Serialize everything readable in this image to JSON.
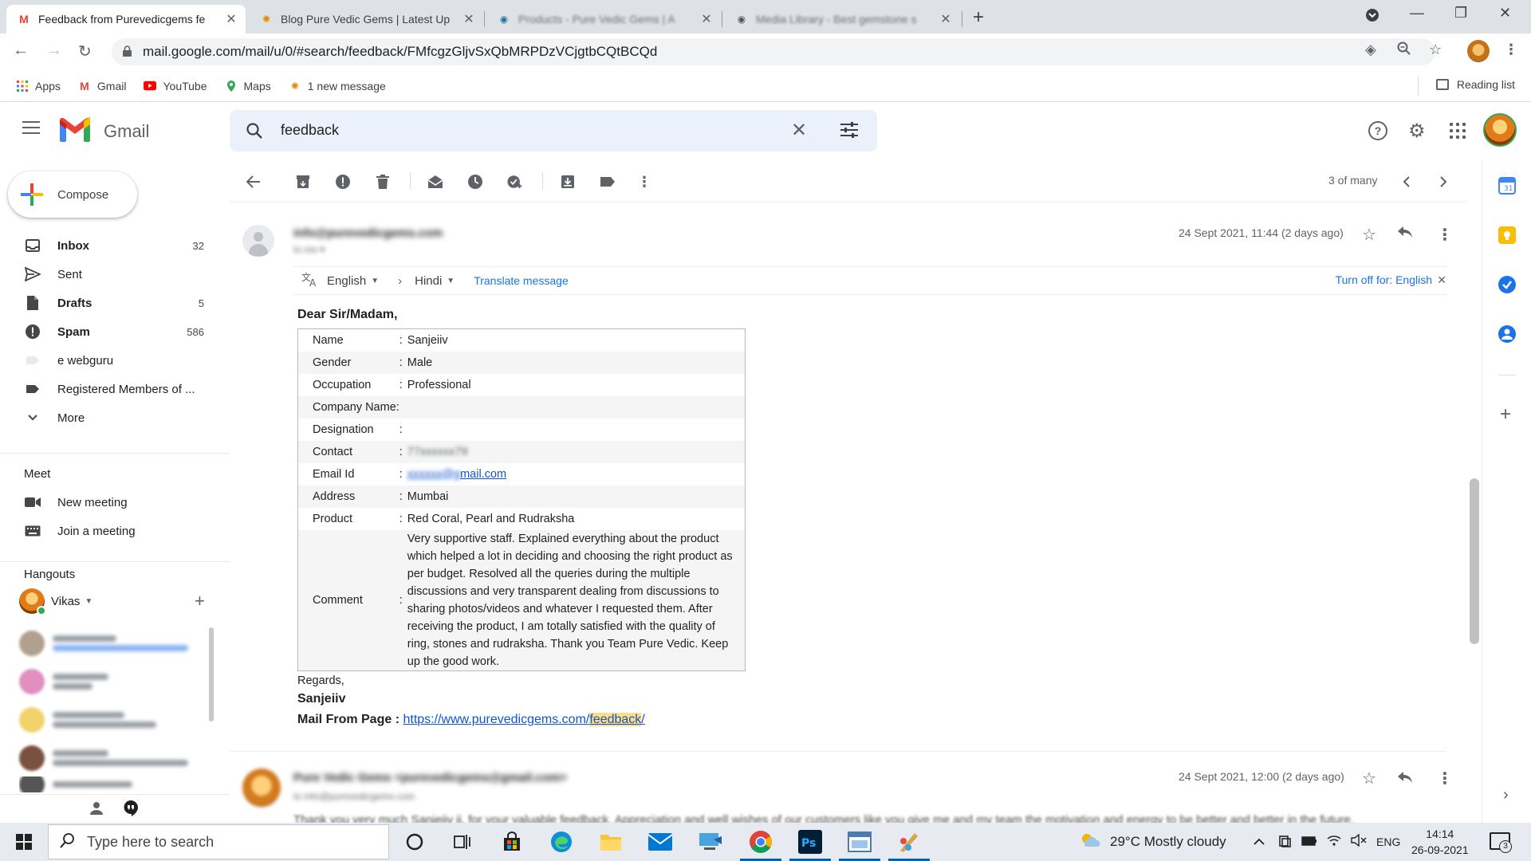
{
  "browser": {
    "tabs": [
      {
        "title": "Feedback from Purevedicgems fe",
        "active": true
      },
      {
        "title": "Blog Pure Vedic Gems | Latest Up",
        "active": false
      },
      {
        "title": "Products - Pure Vedic Gems | A",
        "active": false
      },
      {
        "title": "Media Library - Best gemstone s",
        "active": false
      }
    ],
    "url": "mail.google.com/mail/u/0/#search/feedback/FMfcgzGljvSxQbMRPDzVCjgtbCQtBCQd",
    "bookmarks": [
      "Apps",
      "Gmail",
      "YouTube",
      "Maps",
      "1 new message"
    ],
    "reading_list": "Reading list"
  },
  "gmail": {
    "wordmark": "Gmail",
    "search_query": "feedback",
    "compose_label": "Compose",
    "nav": [
      {
        "label": "Inbox",
        "count": "32",
        "bold": true
      },
      {
        "label": "Sent",
        "count": "",
        "bold": false
      },
      {
        "label": "Drafts",
        "count": "5",
        "bold": true
      },
      {
        "label": "Spam",
        "count": "586",
        "bold": true
      },
      {
        "label": "e webguru",
        "count": "",
        "bold": false
      },
      {
        "label": "Registered Members of ...",
        "count": "",
        "bold": false
      },
      {
        "label": "More",
        "count": "",
        "bold": false
      }
    ],
    "meet": {
      "heading": "Meet",
      "new_meeting": "New meeting",
      "join_meeting": "Join a meeting"
    },
    "hangouts": {
      "heading": "Hangouts",
      "user": "Vikas"
    },
    "pager": "3 of many"
  },
  "message": {
    "date": "24 Sept 2021, 11:44 (2 days ago)",
    "translate": {
      "from": "English",
      "to": "Hindi",
      "action": "Translate message",
      "turn_off": "Turn off for: English"
    },
    "greeting": "Dear Sir/Madam,",
    "fields": [
      {
        "key": "Name",
        "value": "Sanjeiiv"
      },
      {
        "key": "Gender",
        "value": "Male"
      },
      {
        "key": "Occupation",
        "value": "Professional"
      },
      {
        "key": "Company Name:",
        "value": ""
      },
      {
        "key": "Designation",
        "value": ""
      },
      {
        "key": "Contact",
        "value": ""
      },
      {
        "key": "Email Id",
        "value": "mail.com"
      },
      {
        "key": "Address",
        "value": "Mumbai"
      },
      {
        "key": "Product",
        "value": "Red Coral, Pearl and Rudraksha"
      },
      {
        "key": "Comment",
        "value": "Very supportive staff. Explained everything about the product which helped a lot in deciding and choosing the right product as per budget. Resolved all the queries during the multiple discussions and very transparent dealing from discussions to sharing photos/videos and whatever I requested them. After receiving the product, I am totally satisfied with the quality of ring, stones and rudraksha. Thank you Team Pure Vedic. Keep up the good work."
      }
    ],
    "regards": "Regards,",
    "signature": "Sanjeiiv",
    "mail_from_label": "Mail From Page :",
    "mail_from_prefix": "https://www.purevedicgems.com/",
    "mail_from_highlight": "feedback",
    "mail_from_suffix": "/"
  },
  "message2": {
    "date": "24 Sept 2021, 12:00 (2 days ago)"
  },
  "taskbar": {
    "search_placeholder": "Type here to search",
    "weather": "29°C  Mostly cloudy",
    "language": "ENG",
    "time": "14:14",
    "date": "26-09-2021",
    "notification_count": "3"
  },
  "colors": {
    "gmail_red": "#ea4335",
    "link_blue": "#1a73e8",
    "highlight": "#fddd85",
    "search_bg": "#eaf1fb"
  }
}
